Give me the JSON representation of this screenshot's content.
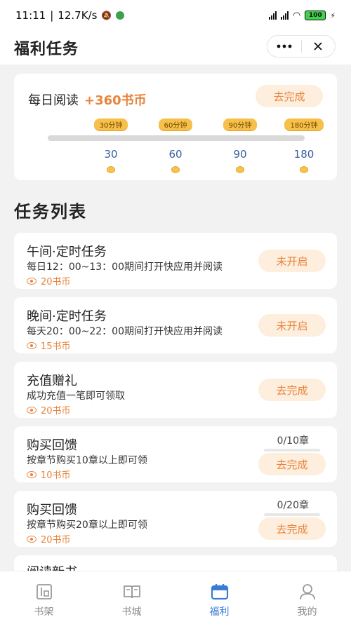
{
  "status_bar": {
    "time": "11:11",
    "network_speed": "12.7K/s",
    "battery": "100"
  },
  "header": {
    "title": "福利任务",
    "more_icon": "more-dots-icon",
    "close_icon": "close-icon"
  },
  "daily_reading": {
    "title": "每日阅读",
    "reward": "+360书币",
    "button_label": "去完成",
    "progress": 0,
    "milestones": [
      {
        "tag": "30分钟",
        "value": "30"
      },
      {
        "tag": "60分钟",
        "value": "60"
      },
      {
        "tag": "90分钟",
        "value": "90"
      },
      {
        "tag": "180分钟",
        "value": "180"
      }
    ]
  },
  "task_list": {
    "title": "任务列表",
    "items": [
      {
        "title": "午间·定时任务",
        "desc": "每日12：00~13：00期间打开快应用并阅读",
        "reward": "20书币",
        "button": "未开启"
      },
      {
        "title": "晚间·定时任务",
        "desc": "每天20：00~22：00期间打开快应用并阅读",
        "reward": "15书币",
        "button": "未开启"
      },
      {
        "title": "充值赠礼",
        "desc": "成功充值一笔即可领取",
        "reward": "20书币",
        "button": "去完成"
      },
      {
        "title": "购买回馈",
        "desc": "按章节购买10章以上即可领",
        "reward": "10书币",
        "button": "去完成",
        "progress_text": "0/10章",
        "progress": 0
      },
      {
        "title": "购买回馈",
        "desc": "按章节购买20章以上即可领",
        "reward": "20书币",
        "button": "去完成",
        "progress_text": "0/20章",
        "progress": 0
      },
      {
        "title": "阅读新书"
      }
    ]
  },
  "tab_bar": {
    "tabs": [
      {
        "label": "书架",
        "icon": "bookshelf-icon"
      },
      {
        "label": "书城",
        "icon": "book-store-icon"
      },
      {
        "label": "福利",
        "icon": "welfare-calendar-icon",
        "active": true
      },
      {
        "label": "我的",
        "icon": "profile-icon"
      }
    ]
  },
  "colors": {
    "accent": "#e8843c",
    "active_tab": "#3a7bd5",
    "milestone_tag": "#f7c04a"
  }
}
